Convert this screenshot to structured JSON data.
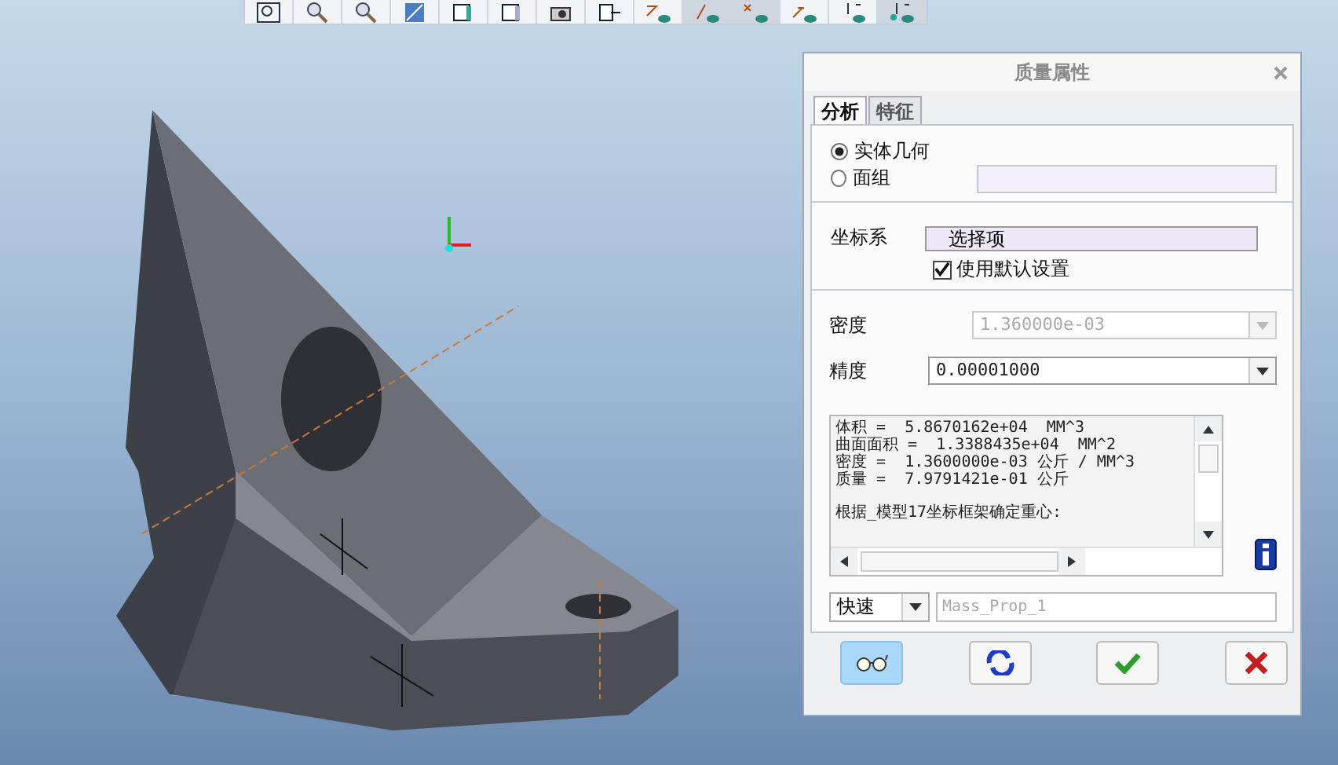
{
  "toolbar": {
    "buttons": [
      {
        "kind": "zoom-box",
        "selected": false
      },
      {
        "kind": "zoom-in",
        "selected": false
      },
      {
        "kind": "zoom-out",
        "selected": false
      },
      {
        "kind": "refit",
        "selected": false
      },
      {
        "kind": "shade",
        "selected": false
      },
      {
        "kind": "view",
        "selected": false
      },
      {
        "kind": "camera",
        "selected": false
      },
      {
        "kind": "orient",
        "selected": false
      },
      {
        "kind": "plane",
        "selected": false
      },
      {
        "kind": "axis",
        "selected": true
      },
      {
        "kind": "point",
        "selected": true
      },
      {
        "kind": "csys",
        "selected": false
      },
      {
        "kind": "spin",
        "selected": false
      },
      {
        "kind": "annot",
        "selected": true
      }
    ]
  },
  "dialog": {
    "title": "质量属性",
    "tabs": [
      {
        "label": "分析",
        "selected": true
      },
      {
        "label": "特征",
        "selected": false
      }
    ],
    "geometry": [
      {
        "label": "实体几何",
        "selected": true
      },
      {
        "label": "面组",
        "selected": false
      }
    ],
    "csys": {
      "label": "坐标系",
      "value": "选择项",
      "default": {
        "label": "使用默认设置",
        "checked": true
      }
    },
    "density": {
      "label": "密度",
      "value": "1.360000e-03",
      "disabled": true
    },
    "precision": {
      "label": "精度",
      "value": "0.00001000"
    },
    "results": {
      "lines": [
        "体积 =  5.8670162e+04  MM^3",
        "曲面面积 =  1.3388435e+04  MM^2",
        "密度 =  1.3600000e-03 公斤 / MM^3",
        "质量 =  7.9791421e-01 公斤"
      ],
      "note": "根据_模型17坐标框架确定重心:"
    },
    "mode": {
      "value": "快速"
    },
    "name": {
      "placeholder": "Mass_Prop_1"
    },
    "buttons": [
      {
        "kind": "preview",
        "selected": true
      },
      {
        "kind": "repeat",
        "selected": false
      },
      {
        "kind": "ok",
        "selected": false
      },
      {
        "kind": "cancel",
        "selected": false
      }
    ]
  }
}
